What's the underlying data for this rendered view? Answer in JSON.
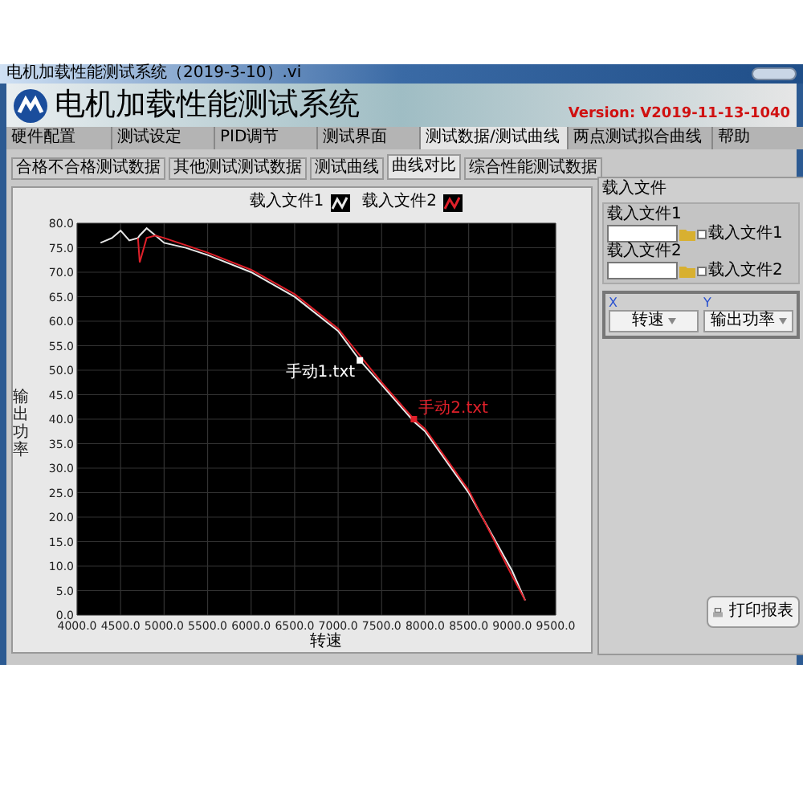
{
  "window": {
    "title": "电机加载性能测试系统（2019-3-10）.vi"
  },
  "header": {
    "title": "电机加载性能测试系统",
    "version": "Version: V2019-11-13-1040"
  },
  "tabs": [
    {
      "label": "硬件配置",
      "selected": false
    },
    {
      "label": "测试设定",
      "selected": false
    },
    {
      "label": "PID调节",
      "selected": false
    },
    {
      "label": "测试界面",
      "selected": false
    },
    {
      "label": "测试数据/测试曲线",
      "selected": true
    },
    {
      "label": "两点测试拟合曲线",
      "selected": false
    },
    {
      "label": "帮助",
      "selected": false
    }
  ],
  "subtabs": [
    {
      "label": "合格不合格测试数据",
      "selected": false
    },
    {
      "label": "其他测试测试数据",
      "selected": false
    },
    {
      "label": "测试曲线",
      "selected": false
    },
    {
      "label": "曲线对比",
      "selected": true
    },
    {
      "label": "综合性能测试数据",
      "selected": false
    }
  ],
  "cursors": [
    {
      "label": "手动1.txt",
      "color": "#ffffff"
    },
    {
      "label": "手动2.txt",
      "color": "#e0202a"
    }
  ],
  "chart_data": {
    "type": "line",
    "grid": true,
    "xlabel": "转速",
    "ylabel": "输出功率",
    "xlim": [
      4000,
      9500
    ],
    "ylim": [
      0,
      80
    ],
    "xticks": [
      {
        "value": 4000,
        "label": "4000.0"
      },
      {
        "value": 4500,
        "label": "4500.0"
      },
      {
        "value": 5000,
        "label": "5000.0"
      },
      {
        "value": 5500,
        "label": "5500.0"
      },
      {
        "value": 6000,
        "label": "6000.0"
      },
      {
        "value": 6500,
        "label": "6500.0"
      },
      {
        "value": 7000,
        "label": "7000.0"
      },
      {
        "value": 7500,
        "label": "7500.0"
      },
      {
        "value": 8000,
        "label": "8000.0"
      },
      {
        "value": 8500,
        "label": "8500.0"
      },
      {
        "value": 9000,
        "label": "9000.0"
      },
      {
        "value": 9500,
        "label": "9500.0"
      }
    ],
    "yticks": [
      {
        "value": 0,
        "label": "0.0"
      },
      {
        "value": 5,
        "label": "5.0"
      },
      {
        "value": 10,
        "label": "10.0"
      },
      {
        "value": 15,
        "label": "15.0"
      },
      {
        "value": 20,
        "label": "20.0"
      },
      {
        "value": 25,
        "label": "25.0"
      },
      {
        "value": 30,
        "label": "30.0"
      },
      {
        "value": 35,
        "label": "35.0"
      },
      {
        "value": 40,
        "label": "40.0"
      },
      {
        "value": 45,
        "label": "45.0"
      },
      {
        "value": 50,
        "label": "50.0"
      },
      {
        "value": 55,
        "label": "55.0"
      },
      {
        "value": 60,
        "label": "60.0"
      },
      {
        "value": 65,
        "label": "65.0"
      },
      {
        "value": 70,
        "label": "70.0"
      },
      {
        "value": 75,
        "label": "75.0"
      },
      {
        "value": 80,
        "label": "80.0"
      }
    ],
    "x": [
      4270,
      4400,
      4500,
      4600,
      4700,
      4720,
      4800,
      4900,
      5000,
      5250,
      5500,
      6000,
      6500,
      7000,
      7250,
      7500,
      7870,
      8000,
      8500,
      9000,
      9150
    ],
    "series": [
      {
        "name": "载入文件1",
        "color": "#e8e8e8",
        "values": [
          76,
          77,
          78.5,
          76.5,
          77,
          77.5,
          79,
          77.5,
          76,
          75,
          73.5,
          70,
          65,
          58,
          52,
          47,
          39.5,
          37.5,
          25,
          9,
          3
        ]
      },
      {
        "name": "载入文件2",
        "color": "#e0202a",
        "values": [
          null,
          null,
          null,
          null,
          77,
          72,
          77,
          77.5,
          77,
          75.5,
          74,
          70.5,
          65.5,
          58.5,
          53,
          47.5,
          40,
          38,
          25.5,
          8,
          3
        ]
      }
    ]
  },
  "files_panel": {
    "title": "载入文件",
    "fields": [
      {
        "label": "载入文件1",
        "checkbox": "载入文件1",
        "checked": false
      },
      {
        "label": "载入文件2",
        "checkbox": "载入文件2",
        "checked": false
      }
    ]
  },
  "axes_select": [
    {
      "axis": "X",
      "value": "转速"
    },
    {
      "axis": "Y",
      "value": "输出功率"
    }
  ],
  "print_button": "打印报表"
}
